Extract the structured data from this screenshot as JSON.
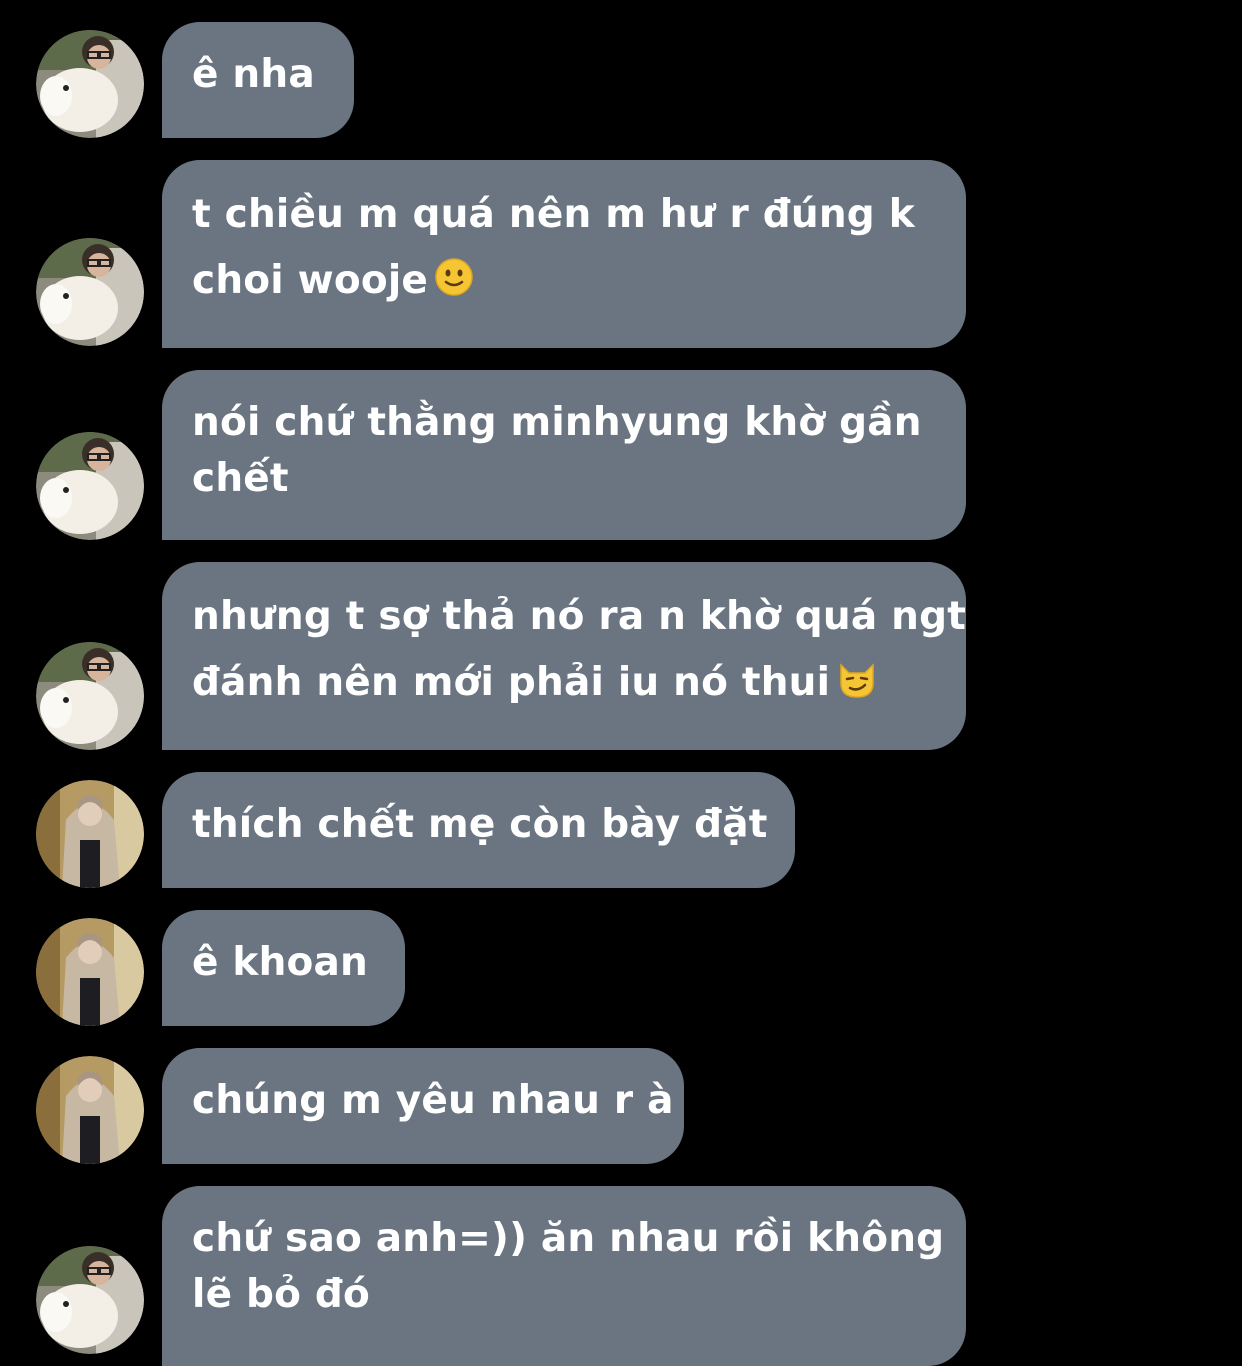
{
  "messages": [
    {
      "sender": "a",
      "lines": [
        "ê nha"
      ]
    },
    {
      "sender": "a",
      "lines": [
        "t chiều m quá nên m hư r đúng k",
        "choi wooje"
      ],
      "emoji": "slightly-smiling-face-icon"
    },
    {
      "sender": "a",
      "lines": [
        "nói chứ thằng minhyung khờ gần",
        "chết"
      ]
    },
    {
      "sender": "a",
      "lines": [
        "nhưng t sợ thả nó ra n khờ quá ngt",
        "đánh nên mới phải iu nó thui"
      ],
      "emoji": "smirking-cat-icon"
    },
    {
      "sender": "b",
      "lines": [
        "thích chết mẹ còn bày đặt"
      ]
    },
    {
      "sender": "b",
      "lines": [
        "ê khoan"
      ]
    },
    {
      "sender": "b",
      "lines": [
        "chúng m yêu nhau r à"
      ]
    },
    {
      "sender": "a",
      "lines": [
        "chứ sao anh=)) ăn nhau rồi không",
        "lẽ bỏ đó"
      ]
    }
  ],
  "colors": {
    "background": "#000000",
    "bubble": "#6a7581",
    "text": "#ffffff"
  }
}
